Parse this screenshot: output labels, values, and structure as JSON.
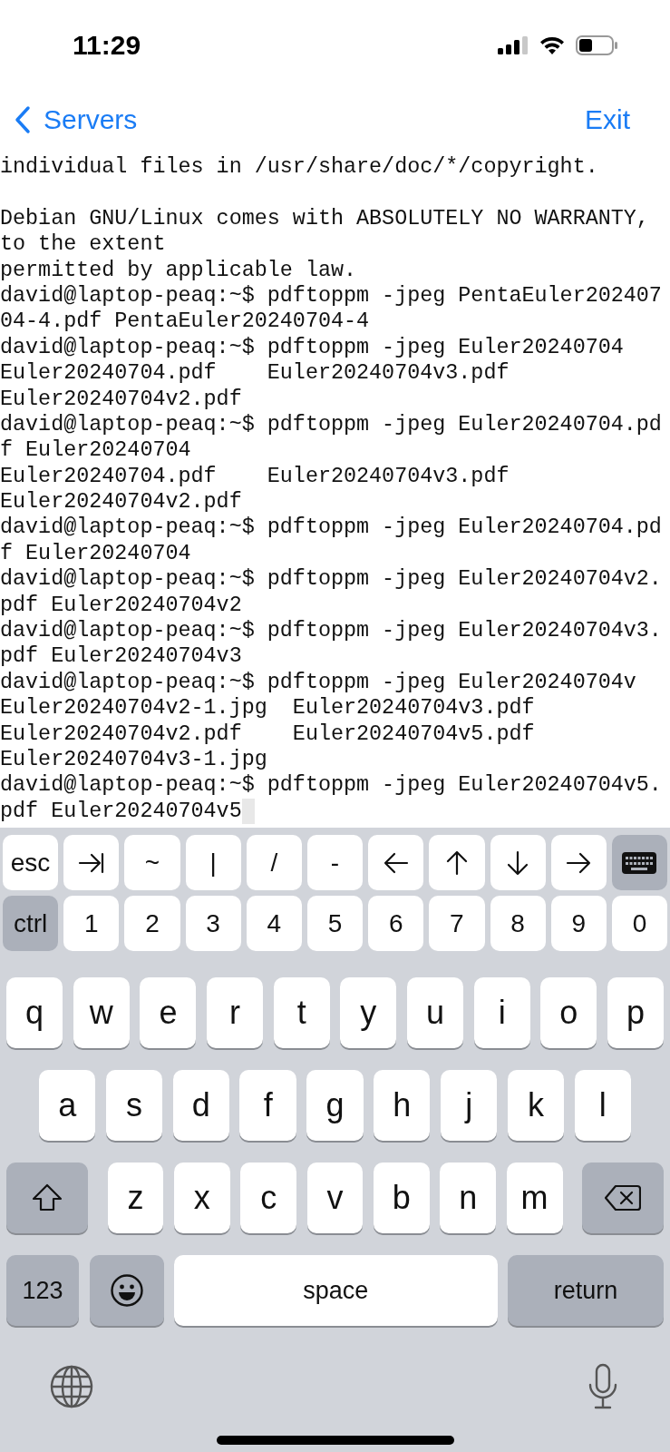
{
  "status_bar": {
    "time": "11:29"
  },
  "nav": {
    "back": "Servers",
    "action": "Exit"
  },
  "terminal": {
    "lines": [
      {
        "text": "individual files in /usr/share/doc/*/copyright.",
        "gap_before": false,
        "cursor": false
      },
      {
        "text": "Debian GNU/Linux comes with ABSOLUTELY NO WARRANTY,",
        "gap_before": true,
        "cursor": false
      },
      {
        "text": "to the extent",
        "gap_before": false,
        "cursor": false
      },
      {
        "text": "permitted by applicable law.",
        "gap_before": false,
        "cursor": false
      },
      {
        "text": "david@laptop-peaq:~$ pdftoppm -jpeg PentaEuler202407",
        "gap_before": false,
        "cursor": false
      },
      {
        "text": "04-4.pdf PentaEuler20240704-4",
        "gap_before": false,
        "cursor": false
      },
      {
        "text": "david@laptop-peaq:~$ pdftoppm -jpeg Euler20240704",
        "gap_before": false,
        "cursor": false
      },
      {
        "text": "Euler20240704.pdf    Euler20240704v3.pdf",
        "gap_before": false,
        "cursor": false
      },
      {
        "text": "Euler20240704v2.pdf",
        "gap_before": false,
        "cursor": false
      },
      {
        "text": "david@laptop-peaq:~$ pdftoppm -jpeg Euler20240704.pd",
        "gap_before": false,
        "cursor": false
      },
      {
        "text": "f Euler20240704",
        "gap_before": false,
        "cursor": false
      },
      {
        "text": "Euler20240704.pdf    Euler20240704v3.pdf",
        "gap_before": false,
        "cursor": false
      },
      {
        "text": "Euler20240704v2.pdf",
        "gap_before": false,
        "cursor": false
      },
      {
        "text": "david@laptop-peaq:~$ pdftoppm -jpeg Euler20240704.pd",
        "gap_before": false,
        "cursor": false
      },
      {
        "text": "f Euler20240704",
        "gap_before": false,
        "cursor": false
      },
      {
        "text": "david@laptop-peaq:~$ pdftoppm -jpeg Euler20240704v2.",
        "gap_before": false,
        "cursor": false
      },
      {
        "text": "pdf Euler20240704v2",
        "gap_before": false,
        "cursor": false
      },
      {
        "text": "david@laptop-peaq:~$ pdftoppm -jpeg Euler20240704v3.",
        "gap_before": false,
        "cursor": false
      },
      {
        "text": "pdf Euler20240704v3",
        "gap_before": false,
        "cursor": false
      },
      {
        "text": "david@laptop-peaq:~$ pdftoppm -jpeg Euler20240704v",
        "gap_before": false,
        "cursor": false
      },
      {
        "text": "Euler20240704v2-1.jpg  Euler20240704v3.pdf",
        "gap_before": false,
        "cursor": false
      },
      {
        "text": "Euler20240704v2.pdf    Euler20240704v5.pdf",
        "gap_before": false,
        "cursor": false
      },
      {
        "text": "Euler20240704v3-1.jpg",
        "gap_before": false,
        "cursor": false
      },
      {
        "text": "david@laptop-peaq:~$ pdftoppm -jpeg Euler20240704v5.",
        "gap_before": false,
        "cursor": false
      },
      {
        "text": "pdf Euler20240704v5",
        "gap_before": false,
        "cursor": true
      }
    ]
  },
  "accessory_rows": [
    [
      {
        "kind": "key",
        "label": "esc"
      },
      {
        "kind": "tab"
      },
      {
        "kind": "key",
        "label": "~"
      },
      {
        "kind": "key",
        "label": "|"
      },
      {
        "kind": "key",
        "label": "/"
      },
      {
        "kind": "key",
        "label": "-"
      },
      {
        "kind": "left"
      },
      {
        "kind": "up"
      },
      {
        "kind": "down"
      },
      {
        "kind": "right"
      },
      {
        "kind": "hide"
      }
    ],
    [
      {
        "kind": "modifier",
        "label": "ctrl"
      },
      {
        "kind": "key",
        "label": "1"
      },
      {
        "kind": "key",
        "label": "2"
      },
      {
        "kind": "key",
        "label": "3"
      },
      {
        "kind": "key",
        "label": "4"
      },
      {
        "kind": "key",
        "label": "5"
      },
      {
        "kind": "key",
        "label": "6"
      },
      {
        "kind": "key",
        "label": "7"
      },
      {
        "kind": "key",
        "label": "8"
      },
      {
        "kind": "key",
        "label": "9"
      },
      {
        "kind": "key",
        "label": "0"
      }
    ]
  ],
  "keyboard_rows": [
    [
      {
        "kind": "key",
        "label": "q"
      },
      {
        "kind": "key",
        "label": "w"
      },
      {
        "kind": "key",
        "label": "e"
      },
      {
        "kind": "key",
        "label": "r"
      },
      {
        "kind": "key",
        "label": "t"
      },
      {
        "kind": "key",
        "label": "y"
      },
      {
        "kind": "key",
        "label": "u"
      },
      {
        "kind": "key",
        "label": "i"
      },
      {
        "kind": "key",
        "label": "o"
      },
      {
        "kind": "key",
        "label": "p"
      }
    ],
    [
      {
        "kind": "key",
        "label": "a"
      },
      {
        "kind": "key",
        "label": "s"
      },
      {
        "kind": "key",
        "label": "d"
      },
      {
        "kind": "key",
        "label": "f"
      },
      {
        "kind": "key",
        "label": "g"
      },
      {
        "kind": "key",
        "label": "h"
      },
      {
        "kind": "key",
        "label": "j"
      },
      {
        "kind": "key",
        "label": "k"
      },
      {
        "kind": "key",
        "label": "l"
      }
    ],
    [
      {
        "kind": "shift"
      },
      {
        "kind": "key",
        "label": "z"
      },
      {
        "kind": "key",
        "label": "x"
      },
      {
        "kind": "key",
        "label": "c"
      },
      {
        "kind": "key",
        "label": "v"
      },
      {
        "kind": "key",
        "label": "b"
      },
      {
        "kind": "key",
        "label": "n"
      },
      {
        "kind": "key",
        "label": "m"
      },
      {
        "kind": "backspace"
      }
    ],
    [
      {
        "kind": "modifier",
        "label": "123"
      },
      {
        "kind": "emoji"
      },
      {
        "kind": "space",
        "label": "space"
      },
      {
        "kind": "return",
        "label": "return"
      }
    ]
  ]
}
